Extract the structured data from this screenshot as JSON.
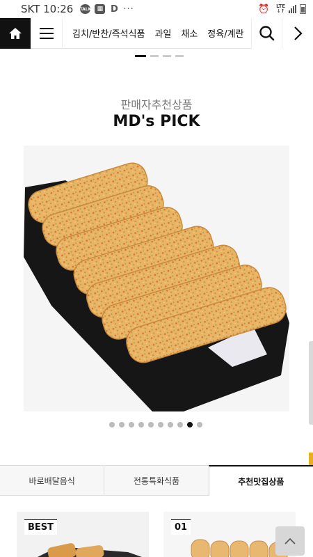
{
  "status_bar": {
    "carrier_time": "SKT 10:26",
    "icons": [
      "talk-icon",
      "image-icon",
      "d-icon"
    ],
    "talk_label": "TALK",
    "d_label": "D",
    "more": "···",
    "network": "LTE"
  },
  "navbar": {
    "categories": [
      "김치/반찬/즉석식품",
      "과일",
      "채소",
      "정육/계란"
    ]
  },
  "section": {
    "subtitle": "판매자추천상품",
    "title": "MD's PICK",
    "slide_count": 10,
    "active_slide": 9
  },
  "tabs": [
    {
      "label": "바로배달음식",
      "active": false
    },
    {
      "label": "전통특화식품",
      "active": false
    },
    {
      "label": "추천맛집상품",
      "active": true
    }
  ],
  "cards": [
    {
      "badge": "BEST"
    },
    {
      "badge": "01"
    }
  ],
  "colors": {
    "home_bg": "#111111",
    "fish_cake": "#e9b767",
    "plate": "#1a1a1a"
  }
}
